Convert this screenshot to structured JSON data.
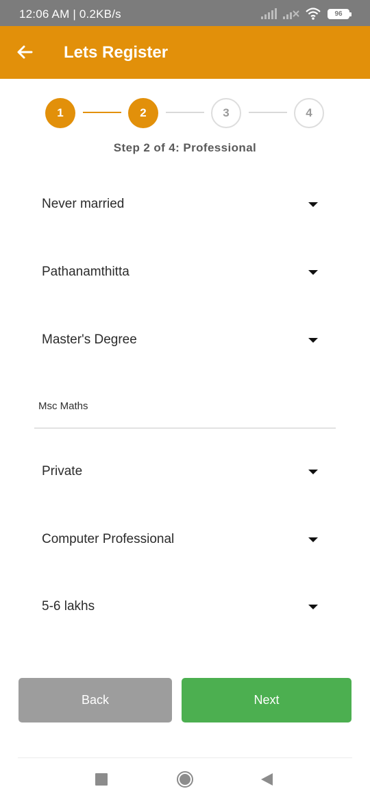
{
  "status_bar": {
    "time_speed": "12:06 AM | 0.2KB/s",
    "battery": "96",
    "icons": [
      "signal-icon",
      "signal-off-icon",
      "wifi-icon",
      "battery-icon"
    ]
  },
  "app_bar": {
    "title": "Lets Register",
    "back_icon": "arrow-left-icon",
    "background": "#e2900a"
  },
  "stepper": {
    "steps": [
      "1",
      "2",
      "3",
      "4"
    ],
    "current_step": 2,
    "caption": "Step 2 of 4: Professional"
  },
  "form": {
    "marital_status": "Never married",
    "district": "Pathanamthitta",
    "education": "Master's Degree",
    "education_detail": "Msc Maths",
    "employed_in": "Private",
    "occupation": "Computer Professional",
    "annual_income": "5-6 lakhs"
  },
  "buttons": {
    "back": "Back",
    "next": "Next",
    "back_color": "#9d9d9d",
    "next_color": "#4caf50"
  },
  "nav_bar": {
    "icons": [
      "recents-square-icon",
      "home-circle-icon",
      "back-triangle-icon"
    ]
  }
}
